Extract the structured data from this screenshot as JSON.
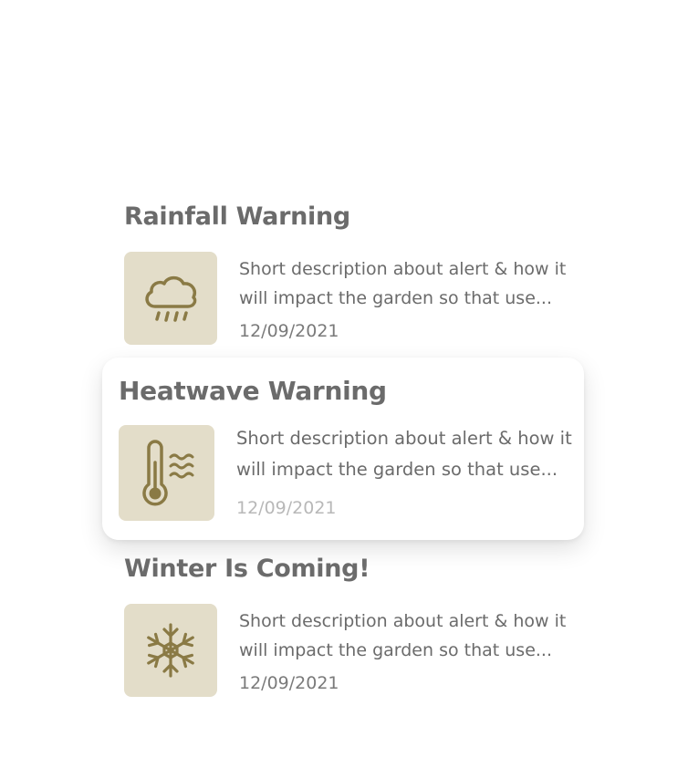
{
  "alerts": [
    {
      "title": "Rainfall Warning",
      "description": "Short description about alert & how it will impact the garden so that use...",
      "date": "12/09/2021",
      "icon": "rain-cloud-icon"
    },
    {
      "title": "Heatwave Warning",
      "description": "Short description about alert & how it will impact the garden so that use...",
      "date": "12/09/2021",
      "icon": "thermometer-heat-icon"
    },
    {
      "title": "Winter Is Coming!",
      "description": "Short description about alert & how it will impact the garden so that use...",
      "date": "12/09/2021",
      "icon": "snowflake-icon"
    }
  ],
  "colors": {
    "icon_tile": "#e3ddc9",
    "icon_stroke": "#8a7a45",
    "title_text": "#6b6b6b",
    "body_text": "#6b6b6b"
  }
}
